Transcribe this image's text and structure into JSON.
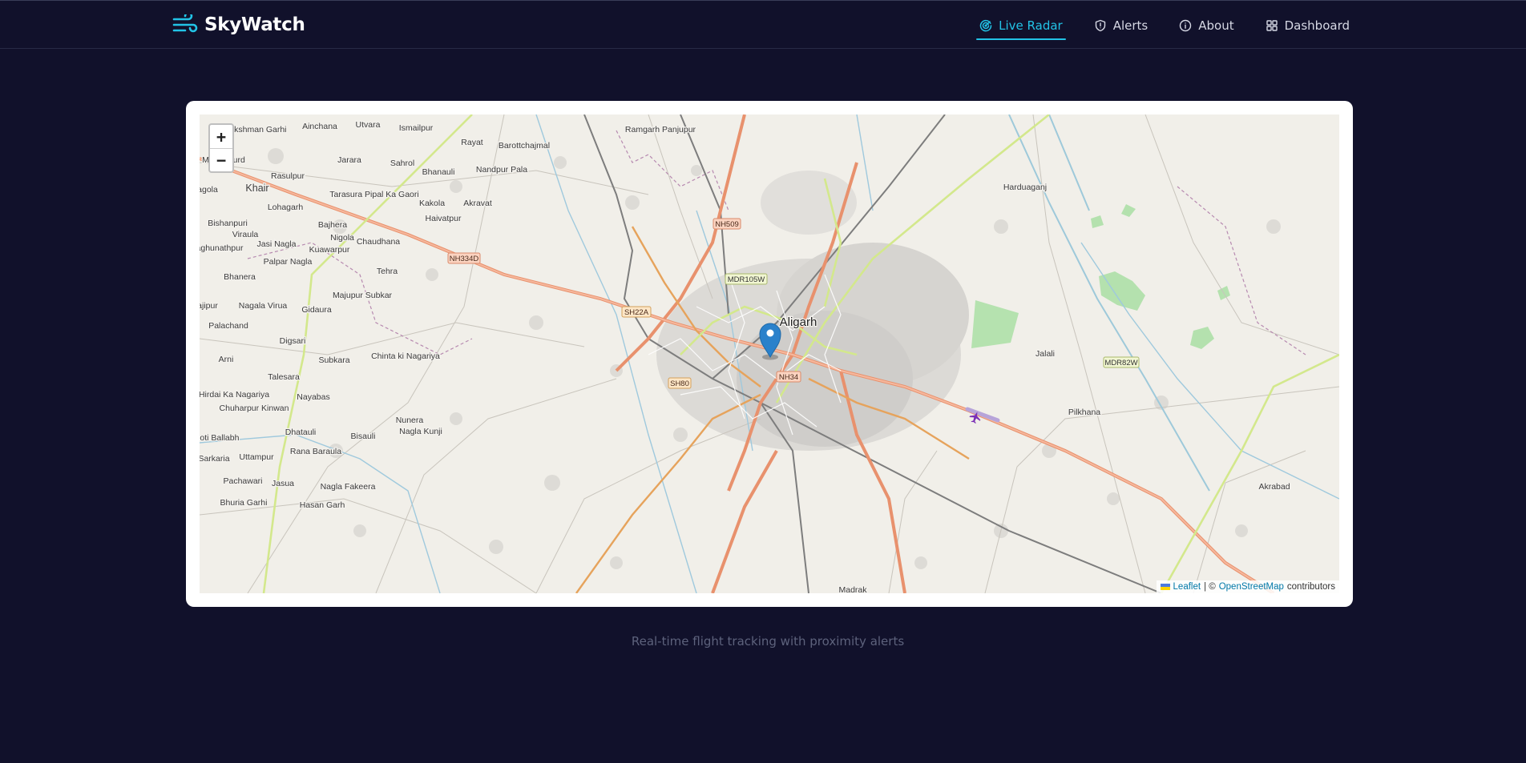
{
  "app": {
    "brand": "SkyWatch",
    "brand_icon": "wind-icon",
    "accent_color": "#22c3e6",
    "background_color": "#11112b"
  },
  "nav": {
    "items": [
      {
        "label": "Live Radar",
        "icon": "radar-icon",
        "active": true
      },
      {
        "label": "Alerts",
        "icon": "shield-icon",
        "active": false
      },
      {
        "label": "About",
        "icon": "info-icon",
        "active": false
      },
      {
        "label": "Dashboard",
        "icon": "grid-icon",
        "active": false
      }
    ]
  },
  "map": {
    "center_city": "Aligarh",
    "zoom_in": "+",
    "zoom_out": "−",
    "attribution": {
      "leaflet": "Leaflet",
      "separator": "| ©",
      "osm": "OpenStreetMap",
      "suffix": "contributors"
    },
    "marker_color": "#2a81cb",
    "aircraft_color": "#7b2fb5",
    "places": [
      "Lakshman Garhi",
      "Ainchana",
      "Utvara",
      "Ismailpur",
      "Rayat",
      "Barottchajmal",
      "Ramgarh Panjupur",
      "Harduaganj",
      "Khair",
      "Rasulpur",
      "Jarara",
      "Sahrol",
      "Bhanauli",
      "Nandpur Pala",
      "Tarasura Pipal Ka Gaori",
      "Kakola",
      "Akravat",
      "Haivatpur",
      "Lohagarh",
      "Bishanpuri",
      "Viraula",
      "Jasi Nagla",
      "Bajhera",
      "Nigola",
      "Chaudhana",
      "aghunathpur",
      "Kuawarpur",
      "Palpar Nagla",
      "Bhanera",
      "Tehra",
      "Majupur Subkar",
      "ajipur",
      "Nagala Virua",
      "Gidaura",
      "Palachand",
      "Digsari",
      "Arni",
      "Subkara",
      "Chinta ki Nagariya",
      "Talesara",
      "Hirdai Ka Nagariya",
      "Nayabas",
      "Chuharpur Kinwan",
      "Nunera",
      "Nagla Kunji",
      "Dhatauli",
      "Bisauli",
      "hoti Ballabh",
      "Rana Baraula",
      "Sarkaria",
      "Uttampur",
      "Pachawari",
      "Jasua",
      "Nagla Fakeera",
      "Bhuria Garhi",
      "Hasan Garh",
      "Jalali",
      "Pilkhana",
      "Akrabad",
      "agola",
      "Marpamurd",
      "Madrak",
      "Aligarh"
    ],
    "road_shields": [
      "NH509",
      "NH334D",
      "MDR105W",
      "SH22A",
      "SH80",
      "NH34",
      "MDR82W"
    ]
  },
  "footer": {
    "tagline": "Real-time flight tracking with proximity alerts"
  }
}
